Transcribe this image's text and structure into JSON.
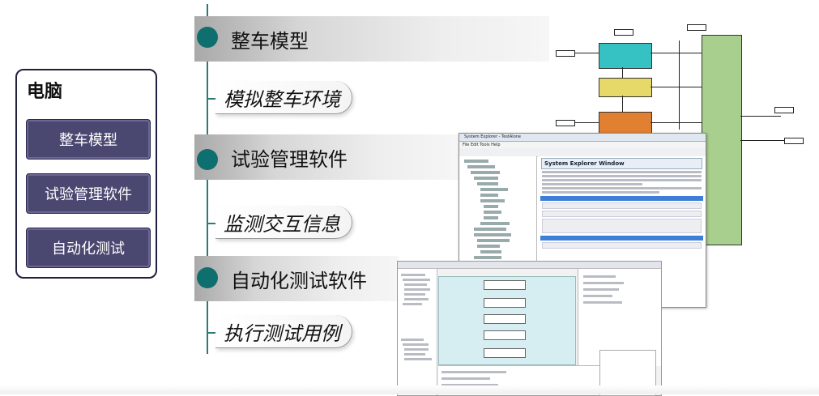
{
  "sidebar": {
    "title": "电脑",
    "items": [
      {
        "label": "整车模型"
      },
      {
        "label": "试验管理软件"
      },
      {
        "label": "自动化测试"
      }
    ]
  },
  "timeline": {
    "stages": [
      {
        "title": "整车模型",
        "subtitle": "模拟整车环境"
      },
      {
        "title": "试验管理软件",
        "subtitle": "监测交互信息"
      },
      {
        "title": "自动化测试软件",
        "subtitle": "执行测试用例"
      }
    ]
  },
  "system_explorer": {
    "window_title": "System Explorer - TestAlone",
    "menu": "File   Edit   Tools   Help",
    "heading": "System Explorer Window"
  },
  "colors": {
    "accent_teal": "#0f6e6e",
    "sidebar_button": "#4a4770"
  }
}
